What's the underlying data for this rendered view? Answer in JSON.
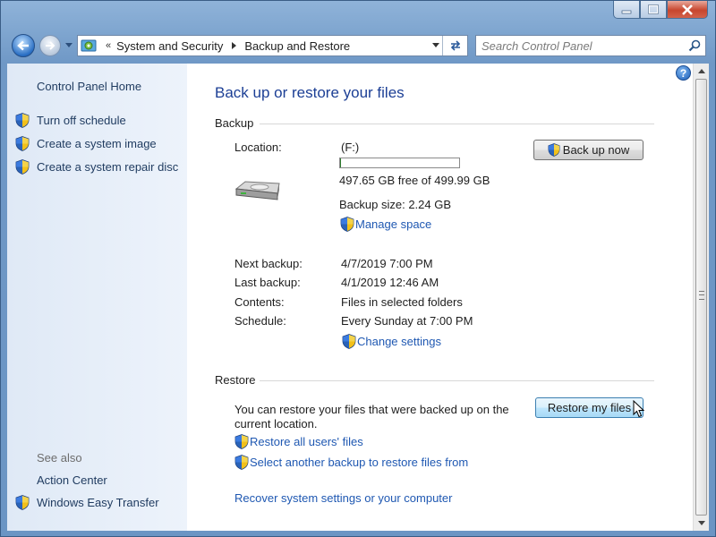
{
  "window": {
    "breadcrumb_overflow": "«",
    "breadcrumbs": [
      "System and Security",
      "Backup and Restore"
    ],
    "search_placeholder": "Search Control Panel"
  },
  "sidebar": {
    "home_link": "Control Panel Home",
    "tasks": [
      {
        "label": "Turn off schedule",
        "icon": "uac-shield-icon"
      },
      {
        "label": "Create a system image",
        "icon": "uac-shield-icon"
      },
      {
        "label": "Create a system repair disc",
        "icon": "uac-shield-icon"
      }
    ],
    "see_also_heading": "See also",
    "see_also": [
      {
        "label": "Action Center"
      },
      {
        "label": "Windows Easy Transfer",
        "icon": "uac-shield-icon"
      }
    ]
  },
  "main": {
    "title": "Back up or restore your files",
    "backup": {
      "heading": "Backup",
      "location_label": "Location:",
      "location_value": "(F:)",
      "disk_used_fraction": 0.005,
      "free_space": "497.65 GB free of 499.99 GB",
      "backup_size": "Backup size: 2.24 GB",
      "manage_space": "Manage space",
      "back_up_now": "Back up now",
      "details": [
        {
          "label": "Next backup:",
          "value": "4/7/2019 7:00 PM"
        },
        {
          "label": "Last backup:",
          "value": "4/1/2019 12:46 AM"
        },
        {
          "label": "Contents:",
          "value": "Files in selected folders"
        },
        {
          "label": "Schedule:",
          "value": "Every Sunday at 7:00 PM"
        }
      ],
      "change_settings": "Change settings"
    },
    "restore": {
      "heading": "Restore",
      "description_line1": "You can restore your files that were backed up on the",
      "description_line2": "current location.",
      "restore_button": "Restore my files",
      "restore_all": "Restore all users' files",
      "select_another": "Select another backup to restore files from",
      "recover": "Recover system settings or your computer"
    }
  },
  "colors": {
    "heading_blue": "#1c3f95",
    "link_blue": "#1f58b2",
    "sidebar_bg": "#e4edf8"
  }
}
